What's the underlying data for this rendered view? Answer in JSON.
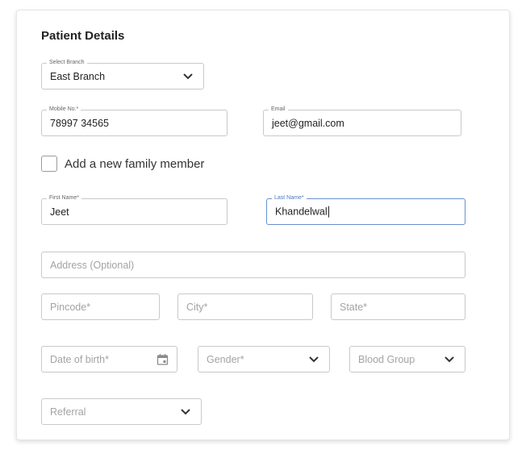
{
  "form": {
    "title": "Patient Details",
    "branch": {
      "label": "Select Branch",
      "value": "East Branch"
    },
    "mobile": {
      "label": "Mobile No.*",
      "value": "78997 34565"
    },
    "email": {
      "label": "Email",
      "value": "jeet@gmail.com"
    },
    "family_member": {
      "label": "Add a new family member",
      "checked": false
    },
    "first_name": {
      "label": "First Name*",
      "value": "Jeet"
    },
    "last_name": {
      "label": "Last Name*",
      "value": "Khandelwal"
    },
    "address": {
      "placeholder": "Address  (Optional)"
    },
    "pincode": {
      "placeholder": "Pincode*"
    },
    "city": {
      "placeholder": "City*"
    },
    "state": {
      "placeholder": "State*"
    },
    "dob": {
      "placeholder": "Date of birth*"
    },
    "gender": {
      "placeholder": "Gender*"
    },
    "blood_group": {
      "placeholder": "Blood Group"
    },
    "referral": {
      "placeholder": "Referral"
    }
  },
  "icons": {
    "dropdown": "chevron-down-icon",
    "calendar": "calendar-icon"
  },
  "colors": {
    "focus": "#4a78c2",
    "border": "#c9c9c9",
    "placeholder": "#a3a3a3"
  }
}
